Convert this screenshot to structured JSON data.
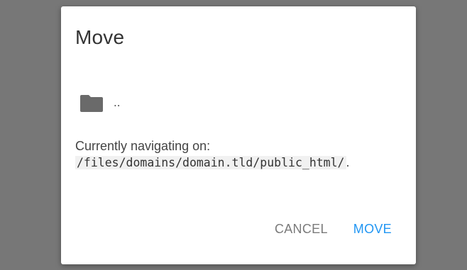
{
  "dialog": {
    "title": "Move",
    "items": [
      {
        "name": "..",
        "icon": "folder-icon"
      }
    ],
    "navigating_label": "Currently navigating on:",
    "current_path": "/files/domains/domain.tld/public_html/",
    "path_suffix": ".",
    "cancel_label": "CANCEL",
    "move_label": "MOVE"
  },
  "colors": {
    "overlay": "#777777",
    "accent": "#2196f3",
    "cancel_text": "#7a7a7a",
    "folder_icon": "#6a6a6a"
  }
}
